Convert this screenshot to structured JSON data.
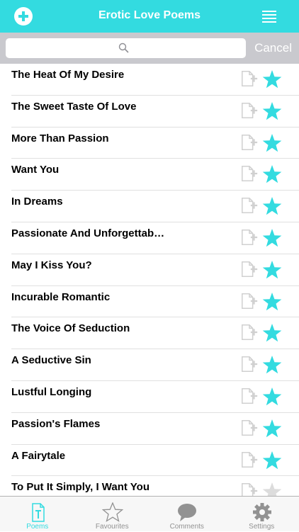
{
  "header": {
    "title": "Erotic Love Poems",
    "add_icon": "plus-circle-icon",
    "menu_icon": "hamburger-menu-icon"
  },
  "search": {
    "value": "",
    "placeholder": "",
    "cancel_label": "Cancel"
  },
  "poems": [
    {
      "title": "The Heat Of My Desire"
    },
    {
      "title": "The Sweet Taste Of Love"
    },
    {
      "title": "More Than Passion"
    },
    {
      "title": "Want You"
    },
    {
      "title": "In Dreams"
    },
    {
      "title": "Passionate And Unforgettab…"
    },
    {
      "title": "May I Kiss You?"
    },
    {
      "title": "Incurable Romantic"
    },
    {
      "title": "The Voice Of Seduction"
    },
    {
      "title": "A Seductive Sin"
    },
    {
      "title": "Lustful Longing"
    },
    {
      "title": "Passion's Flames"
    },
    {
      "title": "A Fairytale"
    },
    {
      "title": "To Put It Simply, I Want You"
    }
  ],
  "tabs": [
    {
      "label": "Poems",
      "icon": "poems-document-icon",
      "active": true
    },
    {
      "label": "Favourites",
      "icon": "star-outline-icon",
      "active": false
    },
    {
      "label": "Comments",
      "icon": "speech-bubble-icon",
      "active": false
    },
    {
      "label": "Settings",
      "icon": "gear-icon",
      "active": false
    }
  ],
  "colors": {
    "accent": "#33dbe0",
    "search_bar_bg": "#c9c9ce",
    "icon_gray": "#d0d0d0",
    "tab_inactive": "#929292"
  }
}
